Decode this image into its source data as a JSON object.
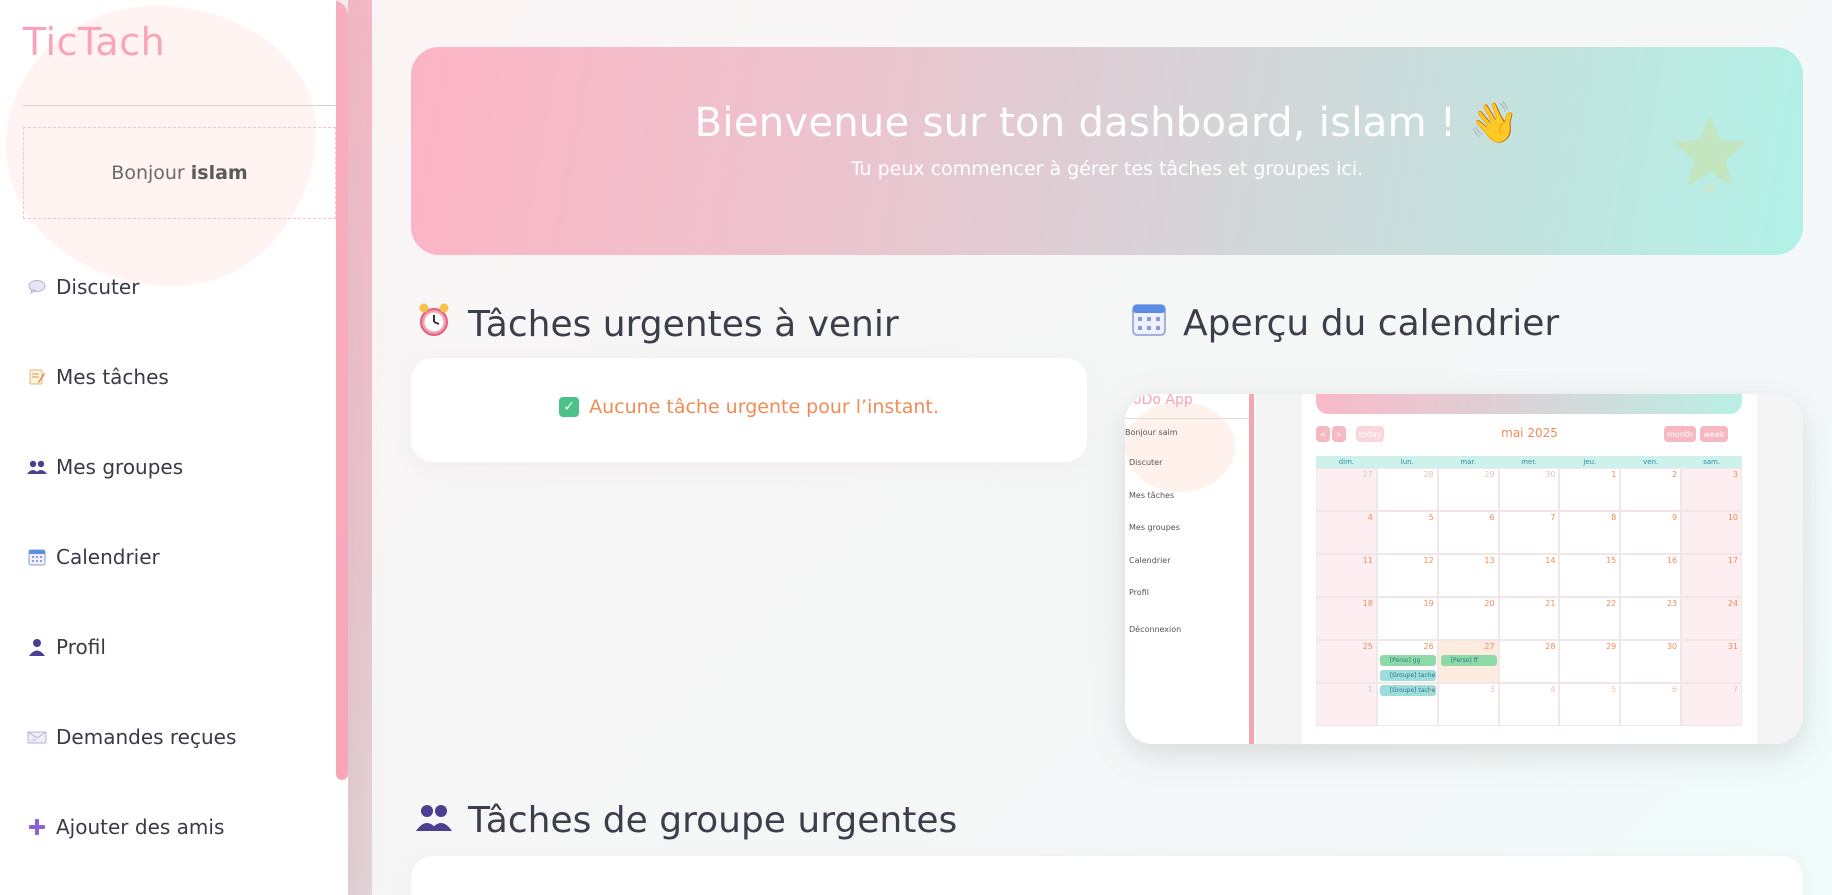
{
  "sidebar": {
    "brand": "TicTach",
    "greeting": "Bonjour",
    "username": "islam",
    "items": [
      {
        "label": "Discuter",
        "icon": "speech-bubble-icon"
      },
      {
        "label": "Mes tâches",
        "icon": "memo-icon"
      },
      {
        "label": "Mes groupes",
        "icon": "users-icon"
      },
      {
        "label": "Calendrier",
        "icon": "calendar-icon"
      },
      {
        "label": "Profil",
        "icon": "user-icon"
      },
      {
        "label": "Demandes reçues",
        "icon": "incoming-envelope-icon"
      },
      {
        "label": "Ajouter des amis",
        "icon": "plus-icon"
      }
    ]
  },
  "hero": {
    "title": "Bienvenue sur ton dashboard, islam ! 👋",
    "subtitle": "Tu peux commencer à gérer tes tâches et groupes ici."
  },
  "urgent": {
    "title": "Tâches urgentes à venir",
    "empty_message": "Aucune tâche urgente pour l’instant."
  },
  "calendar_preview": {
    "title": "Aperçu du calendrier",
    "mini_brand": "oDo App",
    "mini_greeting": "Bonjour saim",
    "mini_nav": [
      "Discuter",
      "Mes tâches",
      "Mes groupes",
      "Calendrier",
      "Profil",
      "Déconnexion"
    ],
    "month": "mai 2025",
    "prev": "<",
    "next": ">",
    "today": "today",
    "month_btn": "month",
    "week_btn": "week",
    "weekdays": [
      "dim.",
      "lun.",
      "mar.",
      "mer.",
      "jeu.",
      "ven.",
      "sam."
    ],
    "weeks": [
      [
        "27",
        "28",
        "29",
        "30",
        "1",
        "2",
        "3"
      ],
      [
        "4",
        "5",
        "6",
        "7",
        "8",
        "9",
        "10"
      ],
      [
        "11",
        "12",
        "13",
        "14",
        "15",
        "16",
        "17"
      ],
      [
        "18",
        "19",
        "20",
        "21",
        "22",
        "23",
        "24"
      ],
      [
        "25",
        "26",
        "27",
        "28",
        "29",
        "30",
        "31"
      ],
      [
        "1",
        "2",
        "3",
        "4",
        "5",
        "6",
        "7"
      ]
    ],
    "events": [
      {
        "label": "[Perso] gg"
      },
      {
        "label": "[Perso] ff"
      },
      {
        "label": "[Groupe] tache 1"
      },
      {
        "label": "[Groupe] tache 2"
      }
    ]
  },
  "group_urgent": {
    "title": "Tâches de groupe urgentes"
  },
  "colors": {
    "brand_pink": "#f9a4b8",
    "accent_orange": "#f08c56",
    "mint": "#b2f1e6"
  }
}
